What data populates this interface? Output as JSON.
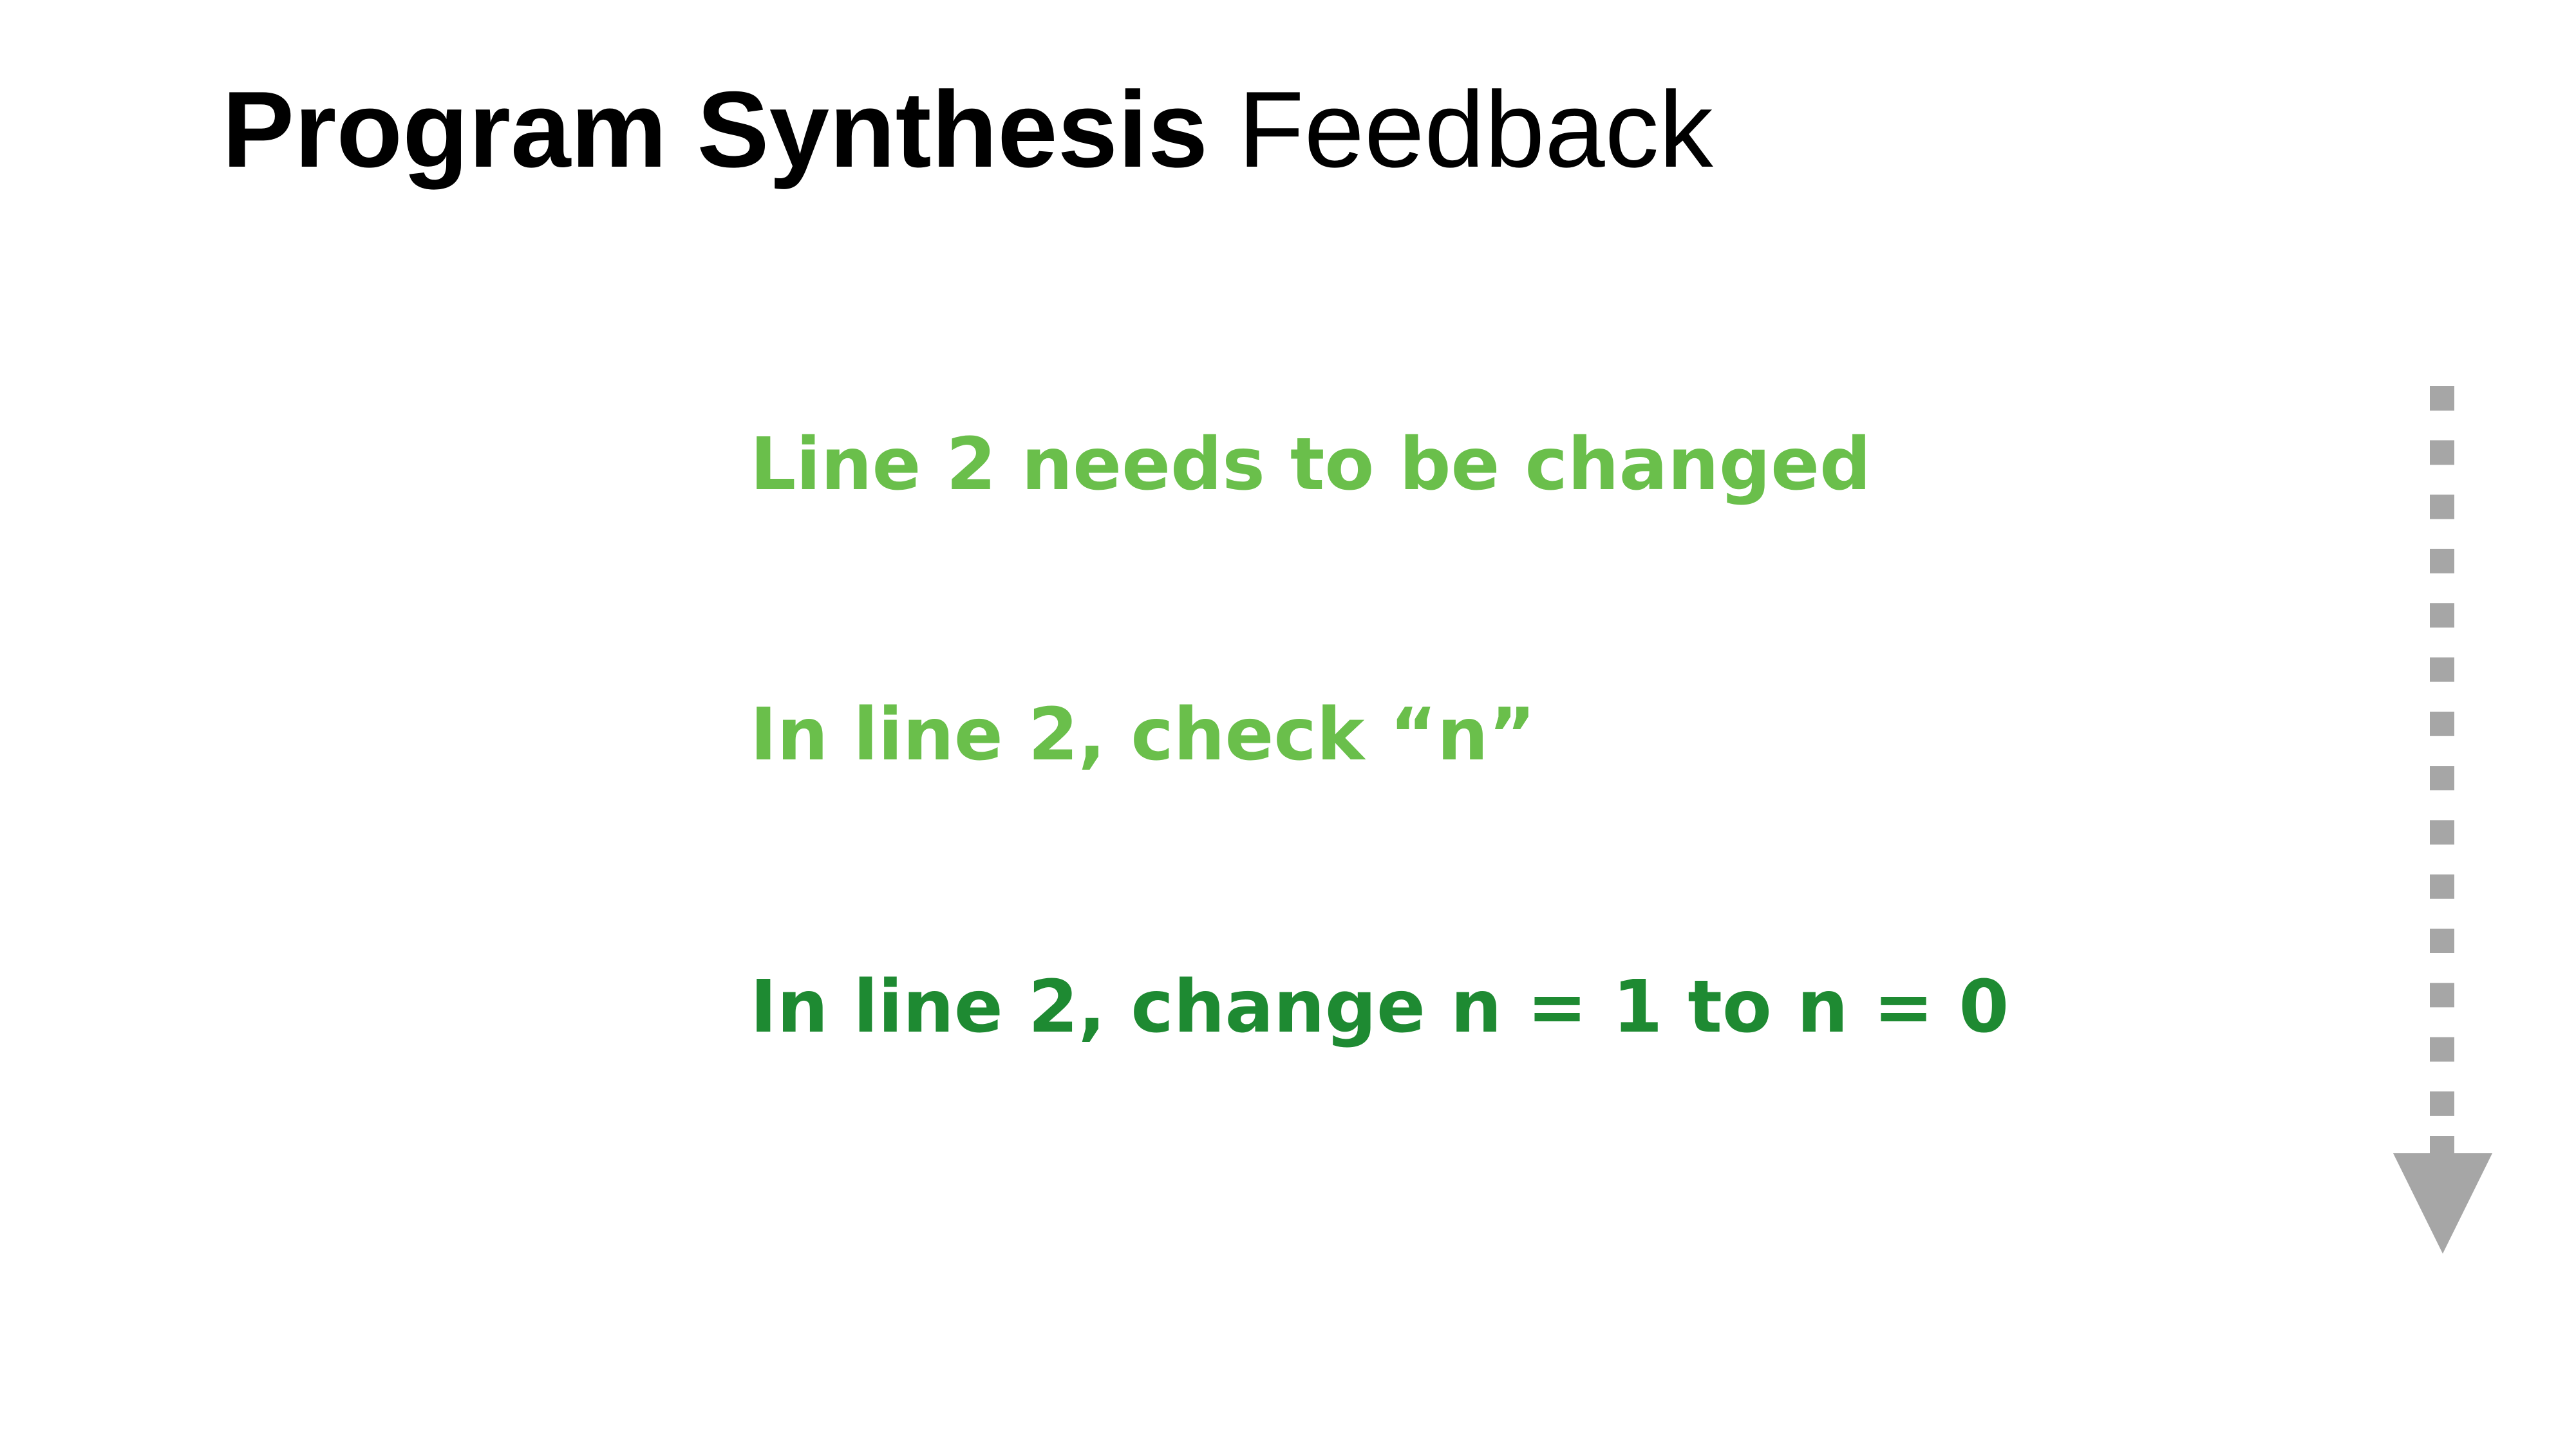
{
  "slide": {
    "title_bold": "Program Synthesis",
    "title_light": "Feedback"
  },
  "feedback_levels": [
    {
      "text": "Line 2 needs to be changed",
      "color": "#6abf4b"
    },
    {
      "text": "In line 2, check “n”",
      "color": "#6abf4b"
    },
    {
      "text": "In line 2, change n = 1 to n = 0",
      "color": "#1e8a32"
    }
  ],
  "arrow": {
    "icon": "dotted-down-arrow-icon",
    "color": "#a6a6a6"
  }
}
